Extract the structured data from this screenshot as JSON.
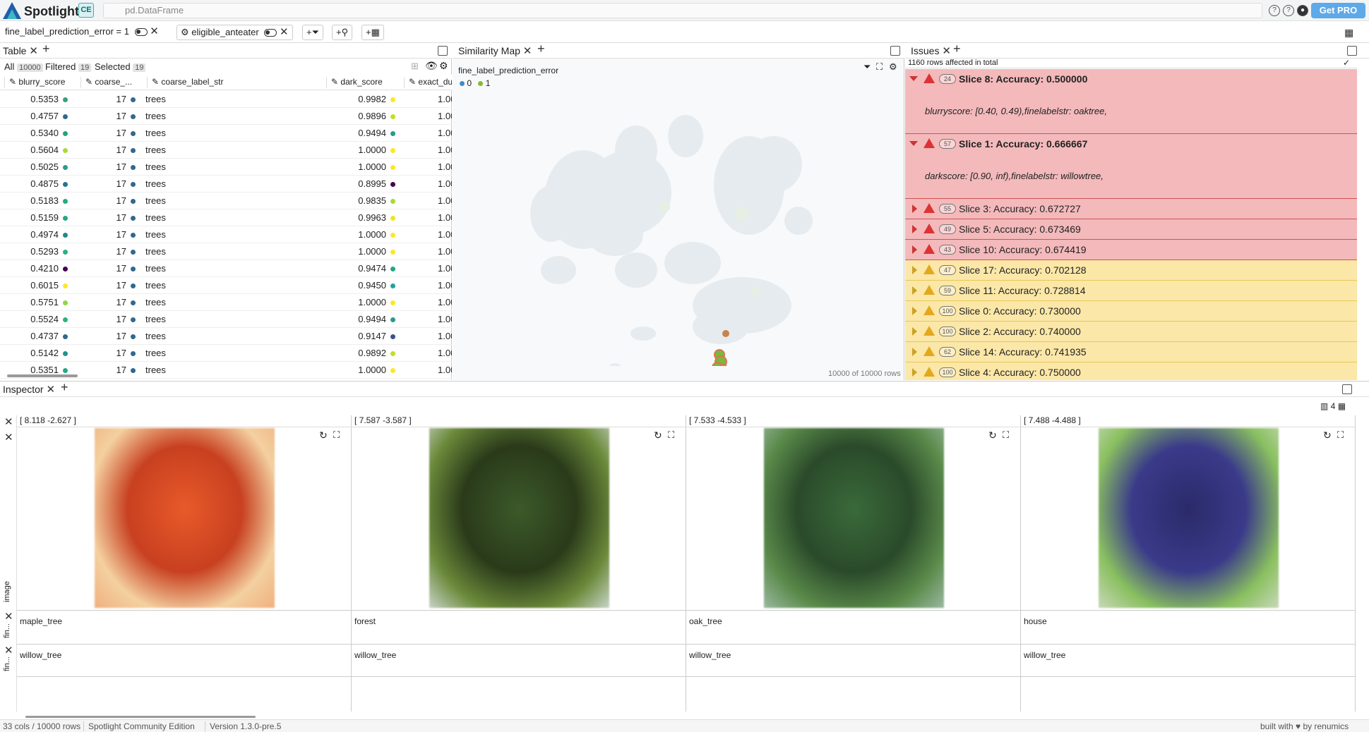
{
  "app": {
    "name": "Spotlight",
    "edition_badge": "CE",
    "dataset": "pd.DataFrame",
    "get_pro": "Get PRO",
    "accent": "#5ea9e8"
  },
  "filters": [
    {
      "label": "fine_label_prediction_error = 1"
    },
    {
      "label": "eligible_anteater"
    }
  ],
  "filter_actions": {
    "add_filter": "+",
    "add_similar": "+",
    "add_tag": "+"
  },
  "table": {
    "tab": "Table",
    "all_label": "All",
    "all_count": "10000",
    "filtered_label": "Filtered",
    "filtered_count": "19",
    "selected_label": "Selected",
    "selected_count": "19",
    "columns": [
      "blurry_score",
      "coarse_...",
      "coarse_label_str",
      "dark_score",
      "exact_du"
    ],
    "rows": [
      [
        "0.5353",
        "17",
        "trees",
        "0.9982",
        "1.00"
      ],
      [
        "0.4757",
        "17",
        "trees",
        "0.9896",
        "1.00"
      ],
      [
        "0.5340",
        "17",
        "trees",
        "0.9494",
        "1.00"
      ],
      [
        "0.5604",
        "17",
        "trees",
        "1.0000",
        "1.00"
      ],
      [
        "0.5025",
        "17",
        "trees",
        "1.0000",
        "1.00"
      ],
      [
        "0.4875",
        "17",
        "trees",
        "0.8995",
        "1.00"
      ],
      [
        "0.5183",
        "17",
        "trees",
        "0.9835",
        "1.00"
      ],
      [
        "0.5159",
        "17",
        "trees",
        "0.9963",
        "1.00"
      ],
      [
        "0.4974",
        "17",
        "trees",
        "1.0000",
        "1.00"
      ],
      [
        "0.5293",
        "17",
        "trees",
        "1.0000",
        "1.00"
      ],
      [
        "0.4210",
        "17",
        "trees",
        "0.9474",
        "1.00"
      ],
      [
        "0.6015",
        "17",
        "trees",
        "0.9450",
        "1.00"
      ],
      [
        "0.5751",
        "17",
        "trees",
        "1.0000",
        "1.00"
      ],
      [
        "0.5524",
        "17",
        "trees",
        "0.9494",
        "1.00"
      ],
      [
        "0.4737",
        "17",
        "trees",
        "0.9147",
        "1.00"
      ],
      [
        "0.5142",
        "17",
        "trees",
        "0.9892",
        "1.00"
      ],
      [
        "0.5351",
        "17",
        "trees",
        "1.0000",
        "1.00"
      ]
    ],
    "blurry_dot_colors": [
      "#3a9e7e",
      "#31688e",
      "#26a17a",
      "#a5db36",
      "#2a9a8a",
      "#2c728e",
      "#23a983",
      "#22a884",
      "#25878d",
      "#2ab07f",
      "#440154",
      "#fde725",
      "#8fd744",
      "#2db27d",
      "#31688e",
      "#21918c",
      "#22a884"
    ],
    "dark_dot_colors": [
      "#fde725",
      "#c2df23",
      "#2a9a8a",
      "#fde725",
      "#fde725",
      "#440154",
      "#a5db36",
      "#f0e51e",
      "#fde725",
      "#fde725",
      "#22a884",
      "#25a0a0",
      "#fde725",
      "#2a9a8a",
      "#3b528b",
      "#c2df23",
      "#fde725"
    ],
    "coarse_dot_color": "#31688e"
  },
  "similarity": {
    "tab": "Similarity Map",
    "legend_title": "fine_label_prediction_error",
    "legend": [
      {
        "label": "0",
        "color": "#3b8fc4"
      },
      {
        "label": "1",
        "color": "#8bb92b"
      }
    ],
    "footer": "10000 of 10000 rows"
  },
  "issues": {
    "tab": "Issues",
    "summary": "1160 rows affected in total",
    "items": [
      {
        "count": "24",
        "title": "Slice 8: Accuracy: 0.500000",
        "expanded": true,
        "severity": "high",
        "detail": "blurryscore: [0.40, 0.49),finelabelstr: oaktree,"
      },
      {
        "count": "57",
        "title": "Slice 1: Accuracy: 0.666667",
        "expanded": true,
        "severity": "high",
        "detail": "darkscore: [0.90, inf),finelabelstr: willowtree,"
      },
      {
        "count": "55",
        "title": "Slice 3: Accuracy: 0.672727",
        "severity": "high"
      },
      {
        "count": "49",
        "title": "Slice 5: Accuracy: 0.673469",
        "severity": "high"
      },
      {
        "count": "43",
        "title": "Slice 10: Accuracy: 0.674419",
        "severity": "high"
      },
      {
        "count": "47",
        "title": "Slice 17: Accuracy: 0.702128",
        "severity": "medium"
      },
      {
        "count": "59",
        "title": "Slice 11: Accuracy: 0.728814",
        "severity": "medium"
      },
      {
        "count": "100",
        "title": "Slice 0: Accuracy: 0.730000",
        "severity": "medium"
      },
      {
        "count": "100",
        "title": "Slice 2: Accuracy: 0.740000",
        "severity": "medium"
      },
      {
        "count": "62",
        "title": "Slice 14: Accuracy: 0.741935",
        "severity": "medium"
      },
      {
        "count": "100",
        "title": "Slice 4: Accuracy: 0.750000",
        "severity": "medium"
      }
    ]
  },
  "inspector": {
    "tab": "Inspector",
    "columns_count": "4",
    "row_labels": [
      "image",
      "fin...",
      "fin..."
    ],
    "cards": [
      {
        "coords": "[ 8.118  -2.627 ]",
        "field1": "maple_tree",
        "field2": "willow_tree"
      },
      {
        "coords": "[ 7.587  -3.587 ]",
        "field1": "forest",
        "field2": "willow_tree"
      },
      {
        "coords": "[ 7.533  -4.533 ]",
        "field1": "oak_tree",
        "field2": "willow_tree"
      },
      {
        "coords": "[ 7.488  -4.488 ]",
        "field1": "house",
        "field2": "willow_tree"
      }
    ]
  },
  "status": {
    "cols_rows": "33 cols / 10000 rows",
    "edition": "Spotlight Community Edition",
    "version": "Version 1.3.0-pre.5",
    "credit": "built with ♥ by renumics"
  }
}
